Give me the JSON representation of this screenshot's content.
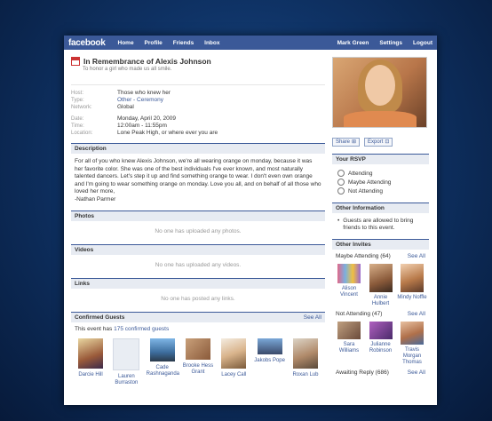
{
  "topbar": {
    "logo": "facebook",
    "nav": [
      "Home",
      "Profile",
      "Friends",
      "Inbox"
    ],
    "right_nav": [
      "Mark Green",
      "Settings",
      "Logout"
    ]
  },
  "event": {
    "title": "In Remembrance of Alexis Johnson",
    "subtitle": "To honor a girl who made us all smile.",
    "info": {
      "host_label": "Host:",
      "host": "Those who knew her",
      "type_label": "Type:",
      "type": "Other - Ceremony",
      "network_label": "Network:",
      "network": "Global",
      "date_label": "Date:",
      "date": "Monday, April 20, 2009",
      "time_label": "Time:",
      "time": "12:00am - 11:55pm",
      "location_label": "Location:",
      "location": "Lone Peak High, or where ever you are"
    }
  },
  "description": {
    "heading": "Description",
    "text": "For all of you who knew Alexis Johnson, we're all wearing orange on monday, because it was her favorite color. She was one of the best individuals I've ever known, and most naturally talented dancers. Let's step it up and find something orange to wear. I don't even own orange and I'm going to wear something orange on monday. Love you all, and on behalf of all those who loved her more,",
    "signature": "-Nathan Parmer"
  },
  "photos": {
    "heading": "Photos",
    "empty": "No one has uploaded any photos."
  },
  "videos": {
    "heading": "Videos",
    "empty": "No one has uploaded any videos."
  },
  "links": {
    "heading": "Links",
    "empty": "No one has posted any links."
  },
  "confirmed": {
    "heading": "Confirmed Guests",
    "see_all": "See All",
    "line_prefix": "This event has",
    "line_link": "175 confirmed guests",
    "guests": [
      "Darcie Hill",
      "Lauren Burraston",
      "Cade Rashnaganda",
      "Brooke Hess Grant",
      "Lacey Call",
      "Jakobs Pope",
      "Roxan Lub"
    ]
  },
  "sidebar": {
    "share_label": "Share",
    "export_label": "Export",
    "rsvp": {
      "heading": "Your RSVP",
      "options": [
        "Attending",
        "Maybe Attending",
        "Not Attending"
      ]
    },
    "other_info": {
      "heading": "Other Information",
      "bullet": "Guests are allowed to bring friends to this event."
    },
    "other_invites": {
      "heading": "Other Invites",
      "maybe_label": "Maybe Attending (64)",
      "maybe_see_all": "See All",
      "maybe": [
        "Alison Vincent",
        "Annie Hulbert",
        "Mindy Noffle"
      ],
      "not_label": "Not Attending (47)",
      "not_see_all": "See All",
      "not": [
        "Sara Williams",
        "Julianne Robinson",
        "Travis Morgan Thomas"
      ],
      "awaiting_label": "Awaiting Reply (686)",
      "awaiting_see_all": "See All"
    }
  },
  "colors": {
    "brand": "#3b5998",
    "section_bg": "#e7ebf2"
  }
}
